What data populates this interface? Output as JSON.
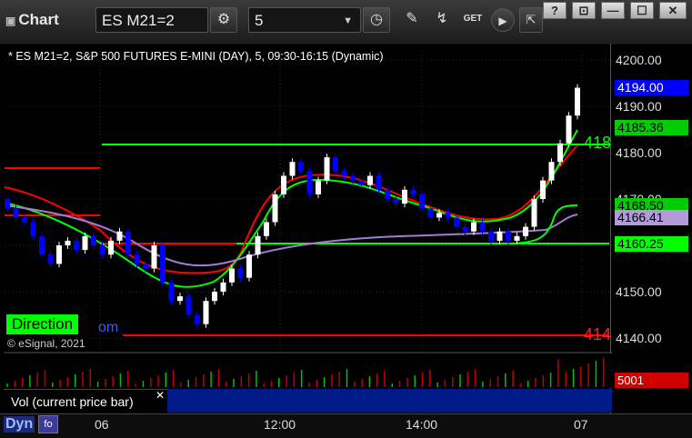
{
  "toolbar": {
    "title": "Chart",
    "symbol": "ES M21=2",
    "interval": "5",
    "title_glyph": "▣",
    "dropdown_glyph": "▼",
    "icons": [
      "gear-icon",
      "clock-icon",
      "pencil-icon",
      "line-study-icon",
      "get-icon",
      "play-icon",
      "export-icon"
    ],
    "window_buttons": [
      "?",
      "⊡",
      "—",
      "☐",
      "✕"
    ]
  },
  "chart": {
    "title": "* ES M21=2, S&P 500 FUTURES E-MINI (DAY), 5, 09:30-16:15 (Dynamic)",
    "direction_label": "Direction",
    "direction_tail": "om",
    "copyright": "© eSignal, 2021",
    "edge_green": "418",
    "edge_red": "414",
    "y_ticks": [
      "4200.00",
      "4190.00",
      "4180.00",
      "4170.00",
      "4150.00",
      "4140.00"
    ],
    "badges": [
      {
        "value": "4194.00",
        "bg": "#0000ff",
        "fg": "#ffffff"
      },
      {
        "value": "4185.36",
        "bg": "#00cc00",
        "fg": "#000000"
      },
      {
        "value": "4168.50",
        "bg": "#00cc00",
        "fg": "#000000"
      },
      {
        "value": "4166.41",
        "bg": "#b19cd9",
        "fg": "#000000"
      },
      {
        "value": "4160.25",
        "bg": "#00ff00",
        "fg": "#000000"
      }
    ],
    "x_ticks": [
      "06",
      "12:00",
      "14:00",
      "07"
    ],
    "colors": {
      "up": "#ffffff",
      "down": "#0000ff",
      "ma_red": "#ff0000",
      "ma_green": "#00ff00",
      "ma_purple": "#a47bd8",
      "hline_green": "#00ff00",
      "hline_red": "#ff0000"
    }
  },
  "volume": {
    "label": "Vol (current price bar)",
    "close_glyph": "✕",
    "value": "5001"
  },
  "status": {
    "dyn_label": "Dyn",
    "dyn_icon_glyph": "fo"
  }
}
